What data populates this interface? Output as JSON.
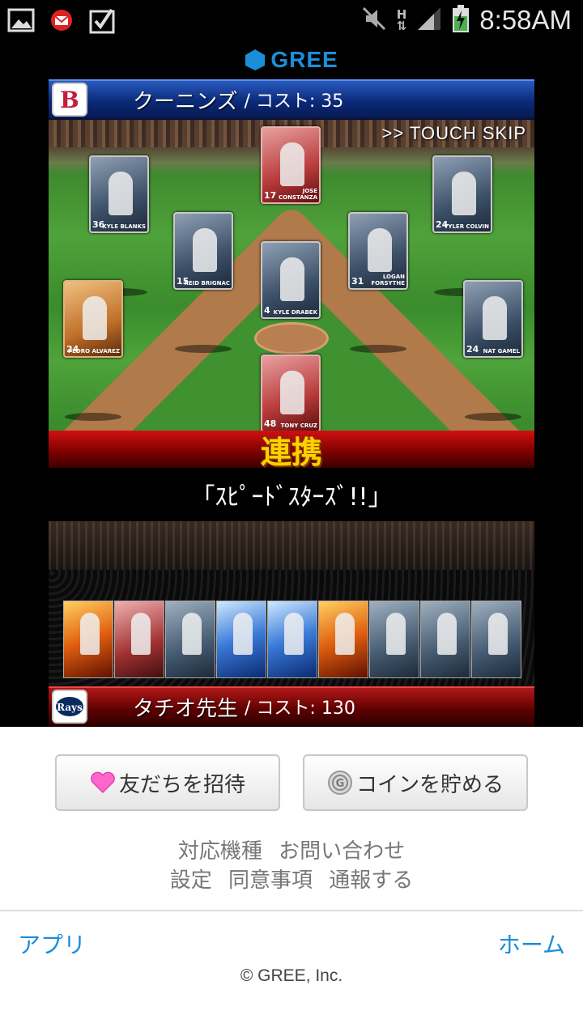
{
  "status_bar": {
    "time": "8:58AM",
    "signal_label": "H",
    "icons": [
      "gallery-icon",
      "mail-notification-icon",
      "task-check-icon",
      "mute-icon",
      "data-arrows-icon",
      "signal-icon",
      "battery-charging-icon"
    ]
  },
  "header": {
    "logo_text": "GREE"
  },
  "game": {
    "top_team": {
      "name": "クーニンズ",
      "cost": "/ コスト: 35",
      "logo": "red-sox-logo"
    },
    "touch_skip": ">> TOUCH SKIP",
    "field_cards": [
      {
        "num": "17",
        "name": "JOSE CONSTANZA",
        "style": "red"
      },
      {
        "num": "36",
        "name": "KYLE BLANKS",
        "style": "blue"
      },
      {
        "num": "24",
        "name": "TYLER COLVIN",
        "style": "blue"
      },
      {
        "num": "15",
        "name": "REID BRIGNAC",
        "style": "blue"
      },
      {
        "num": "31",
        "name": "LOGAN FORSYTHE",
        "style": "blue"
      },
      {
        "num": "4",
        "name": "KYLE DRABEK",
        "style": "blue"
      },
      {
        "num": "24",
        "name": "PEDRO ALVAREZ",
        "style": "orange"
      },
      {
        "num": "24",
        "name": "NAT GAMEL",
        "style": "blue"
      },
      {
        "num": "48",
        "name": "TONY CRUZ",
        "style": "red"
      }
    ],
    "link_title": "連携",
    "link_subtitle": "「ｽﾋﾟｰﾄﾞｽﾀｰｽﾞ!!」",
    "deck_cards": [
      "fire",
      "red",
      "plain",
      "blue",
      "blue",
      "fire",
      "plain",
      "plain",
      "plain"
    ],
    "bottom_team": {
      "name": "タチオ先生",
      "cost": "/ コスト: 130",
      "logo": "rays-logo"
    }
  },
  "footer": {
    "invite_button": "友だちを招待",
    "coin_button": "コインを貯める",
    "links_row1": [
      "対応機種",
      "お問い合わせ"
    ],
    "links_row2": [
      "設定",
      "同意事項",
      "通報する"
    ],
    "nav_left": "アプリ",
    "nav_right": "ホーム",
    "copyright": "© GREE, Inc."
  },
  "colors": {
    "gree_blue": "#1b8ed8",
    "link_gold": "#ffd000",
    "team_blue": "#0b2a7a",
    "team_red": "#5c0000"
  }
}
